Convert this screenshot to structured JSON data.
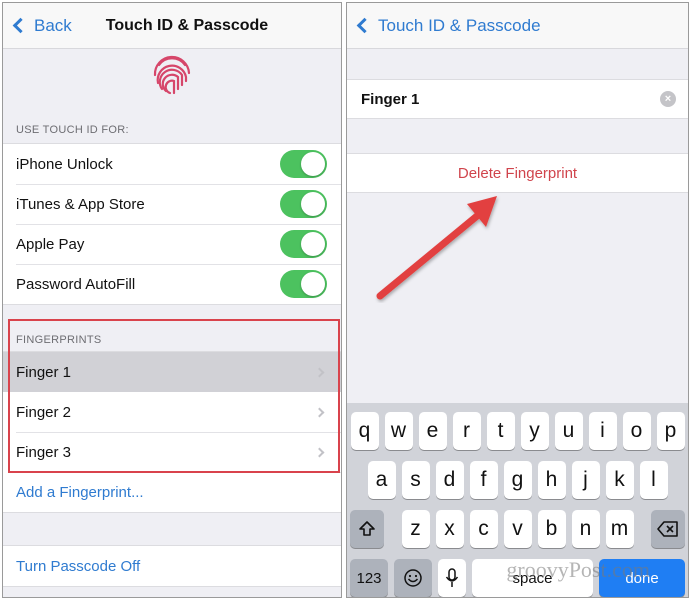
{
  "left_screen": {
    "navbar": {
      "back_label": "Back",
      "title": "Touch ID & Passcode"
    },
    "touch_id_section": {
      "header": "USE TOUCH ID FOR:",
      "items": [
        {
          "label": "iPhone Unlock",
          "enabled": true
        },
        {
          "label": "iTunes & App Store",
          "enabled": true
        },
        {
          "label": "Apple Pay",
          "enabled": true
        },
        {
          "label": "Password AutoFill",
          "enabled": true
        }
      ]
    },
    "fingerprints_section": {
      "header": "FINGERPRINTS",
      "items": [
        {
          "label": "Finger 1",
          "selected": true
        },
        {
          "label": "Finger 2",
          "selected": false
        },
        {
          "label": "Finger 3",
          "selected": false
        }
      ],
      "add_label": "Add a Fingerprint..."
    },
    "turn_passcode_off_label": "Turn Passcode Off"
  },
  "right_screen": {
    "navbar": {
      "back_label": "Touch ID & Passcode"
    },
    "name_field": {
      "value": "Finger 1",
      "placeholder": ""
    },
    "delete_label": "Delete Fingerprint",
    "keyboard": {
      "row1": [
        "q",
        "w",
        "e",
        "r",
        "t",
        "y",
        "u",
        "i",
        "o",
        "p"
      ],
      "row2": [
        "a",
        "s",
        "d",
        "f",
        "g",
        "h",
        "j",
        "k",
        "l"
      ],
      "row3": [
        "z",
        "x",
        "c",
        "v",
        "b",
        "n",
        "m"
      ],
      "numbers_label": "123",
      "space_label": "space",
      "done_label": "done"
    }
  },
  "annotations": {
    "highlight_color": "#d9434c",
    "arrow_color": "#e2403f"
  },
  "watermark": "groovyPost.com",
  "colors": {
    "ios_blue": "#2f7bd0",
    "toggle_green": "#4cc25f",
    "destructive_red": "#d0444c",
    "done_blue": "#1f7ef3"
  }
}
